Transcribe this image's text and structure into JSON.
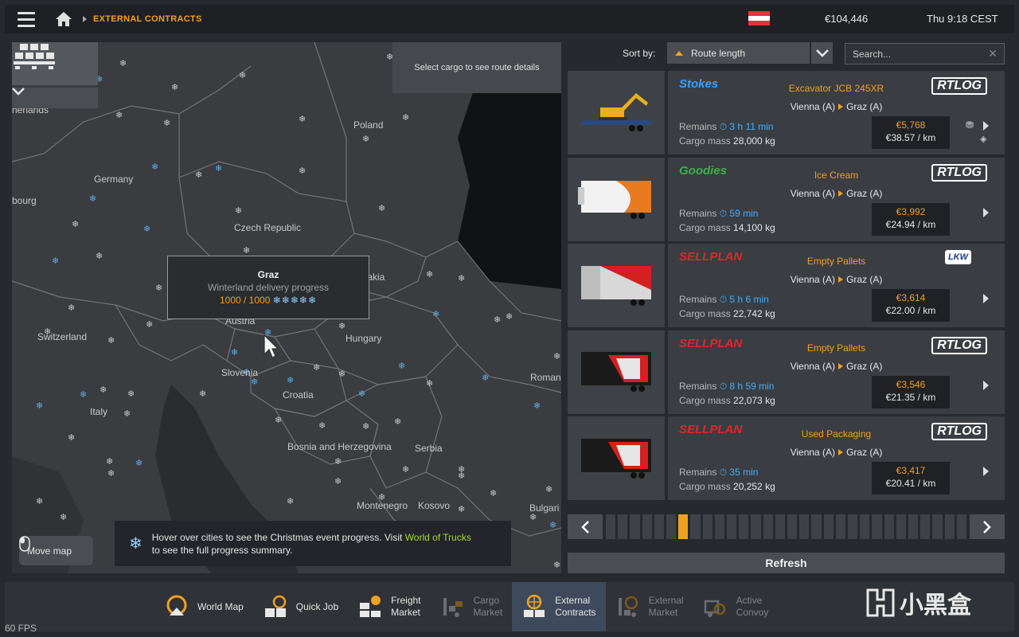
{
  "topbar": {
    "breadcrumb": "EXTERNAL CONTRACTS",
    "money": "€104,446",
    "clock": "Thu 9:18 CEST"
  },
  "map": {
    "route_hint": "Select cargo to see route details",
    "labels": {
      "poland": "Poland",
      "germany": "Germany",
      "czech": "Czech Republic",
      "slovakia": "Slovakia",
      "austria": "Austria",
      "hungary": "Hungary",
      "switzerland": "Switzerland",
      "slovenia": "Slovenia",
      "croatia": "Croatia",
      "italy": "Italy",
      "bosnia": "Bosnia and Herzegovina",
      "serbia": "Serbia",
      "montenegro": "Montenegro",
      "kosovo": "Kosovo",
      "bulgaria": "Bulgari",
      "romania": "Roman",
      "luxembourg": "bourg",
      "netherlands": "herlands"
    },
    "tooltip": {
      "city": "Graz",
      "subtitle": "Winterland delivery progress",
      "progress": "1000 / 1000",
      "flakes": "❄❄❄❄❄"
    },
    "move_map": "Move map",
    "event_text": "Hover over cities to see the Christmas event progress. Visit",
    "event_link": "World of Trucks",
    "event_text2": "to see the full progress summary."
  },
  "sort": {
    "label": "Sort by:",
    "value": "Route length"
  },
  "search": {
    "placeholder": "Search..."
  },
  "jobs": [
    {
      "brand": "Stokes",
      "brand_color": "#3aa0ff",
      "cargo": "Excavator JCB 245XR",
      "from": "Vienna (A)",
      "to": "Graz (A)",
      "company": "RTLOG",
      "remains_label": "Remains",
      "time": "3 h 11 min",
      "mass_label": "Cargo mass",
      "mass": "28,000 kg",
      "total": "€5,768",
      "perkm": "€38.57 / km"
    },
    {
      "brand": "Goodies",
      "brand_color": "#3cb04a",
      "cargo": "Ice Cream",
      "from": "Vienna (A)",
      "to": "Graz (A)",
      "company": "RTLOG",
      "remains_label": "Remains",
      "time": "59 min",
      "mass_label": "Cargo mass",
      "mass": "14,100 kg",
      "total": "€3,992",
      "perkm": "€24.94 / km"
    },
    {
      "brand": "SELLPLAN",
      "brand_color": "#e0262a",
      "cargo": "Empty Pallets",
      "from": "Vienna (A)",
      "to": "Graz (A)",
      "company": "LKW",
      "remains_label": "Remains",
      "time": "5 h 6 min",
      "mass_label": "Cargo mass",
      "mass": "22,742 kg",
      "total": "€3,614",
      "perkm": "€22.00 / km"
    },
    {
      "brand": "SELLPLAN",
      "brand_color": "#e0262a",
      "cargo": "Empty Pallets",
      "from": "Vienna (A)",
      "to": "Graz (A)",
      "company": "RTLOG",
      "remains_label": "Remains",
      "time": "8 h 59 min",
      "mass_label": "Cargo mass",
      "mass": "22,073 kg",
      "total": "€3,546",
      "perkm": "€21.35 / km"
    },
    {
      "brand": "SELLPLAN",
      "brand_color": "#e0262a",
      "cargo": "Used Packaging",
      "from": "Vienna (A)",
      "to": "Graz (A)",
      "company": "RTLOG",
      "remains_label": "Remains",
      "time": "35 min",
      "mass_label": "Cargo mass",
      "mass": "20,252 kg",
      "total": "€3,417",
      "perkm": "€20.41 / km"
    }
  ],
  "pager": {
    "active_page": 6,
    "page_count": 30
  },
  "refresh_label": "Refresh",
  "tabs": [
    {
      "line1": "World Map",
      "line2": ""
    },
    {
      "line1": "Quick Job",
      "line2": ""
    },
    {
      "line1": "Freight",
      "line2": "Market"
    },
    {
      "line1": "Cargo",
      "line2": "Market"
    },
    {
      "line1": "External",
      "line2": "Contracts"
    },
    {
      "line1": "External",
      "line2": "Market"
    },
    {
      "line1": "Active",
      "line2": "Convoy"
    }
  ],
  "fps": "60 FPS",
  "watermark": "小黑盒",
  "colors": {
    "accent": "#f0a020",
    "active_tab": "#3e4a5c",
    "link": "#a8d830",
    "time": "#3fb0ff"
  }
}
